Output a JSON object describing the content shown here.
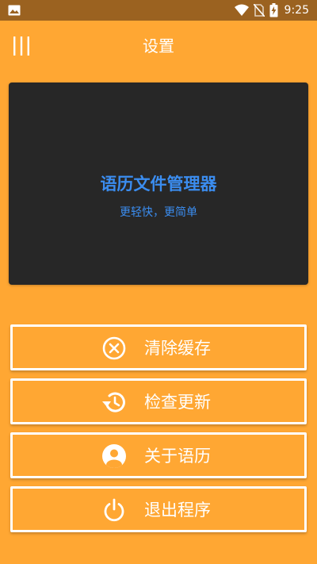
{
  "status_bar": {
    "time": "9:25",
    "left_icon": "image-icon",
    "right_icons": [
      "wifi-icon",
      "no-sim-icon",
      "battery-charging-icon"
    ]
  },
  "app_bar": {
    "title": "设置",
    "menu_icon": "menu-icon"
  },
  "hero": {
    "title": "语历文件管理器",
    "subtitle": "更轻快，更简单"
  },
  "menu": {
    "items": [
      {
        "label": "清除缓存",
        "icon": "clear-cache-icon"
      },
      {
        "label": "检查更新",
        "icon": "history-icon"
      },
      {
        "label": "关于语历",
        "icon": "account-icon"
      },
      {
        "label": "退出程序",
        "icon": "power-icon"
      }
    ]
  },
  "colors": {
    "background": "#ffa733",
    "status_bar": "#9b6220",
    "card": "#272727",
    "accent": "#3b8df0",
    "foreground": "#ffffff"
  }
}
